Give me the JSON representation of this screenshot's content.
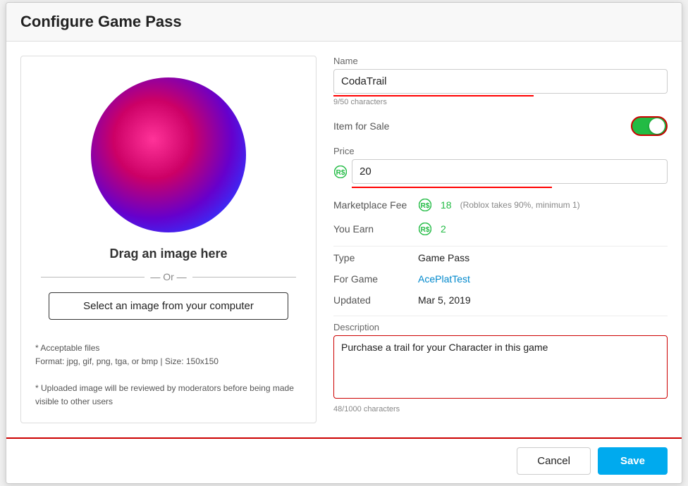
{
  "dialog": {
    "title": "Configure Game Pass"
  },
  "left": {
    "drag_text": "Drag an image here",
    "or_text": "— Or —",
    "select_btn_label": "Select an image from your computer",
    "footer_line1": "* Acceptable files",
    "footer_line2": "Format: jpg, gif, png, tga, or bmp | Size: 150x150",
    "footer_line3": "* Uploaded image will be reviewed by moderators before being made visible to other users"
  },
  "right": {
    "name_label": "Name",
    "name_value": "CodaTrail",
    "name_char_count": "9/50 characters",
    "item_for_sale_label": "Item for Sale",
    "price_label": "Price",
    "price_value": "20",
    "marketplace_fee_label": "Marketplace Fee",
    "marketplace_fee_value": "18",
    "marketplace_fee_note": "(Roblox takes 90%, minimum 1)",
    "you_earn_label": "You Earn",
    "you_earn_value": "2",
    "type_label": "Type",
    "type_value": "Game Pass",
    "for_game_label": "For Game",
    "for_game_value": "AcePlatTest",
    "updated_label": "Updated",
    "updated_value": "Mar 5, 2019",
    "description_label": "Description",
    "description_value": "Purchase a trail for your Character in this game",
    "description_char_count": "48/1000 characters"
  },
  "footer": {
    "cancel_label": "Cancel",
    "save_label": "Save"
  }
}
